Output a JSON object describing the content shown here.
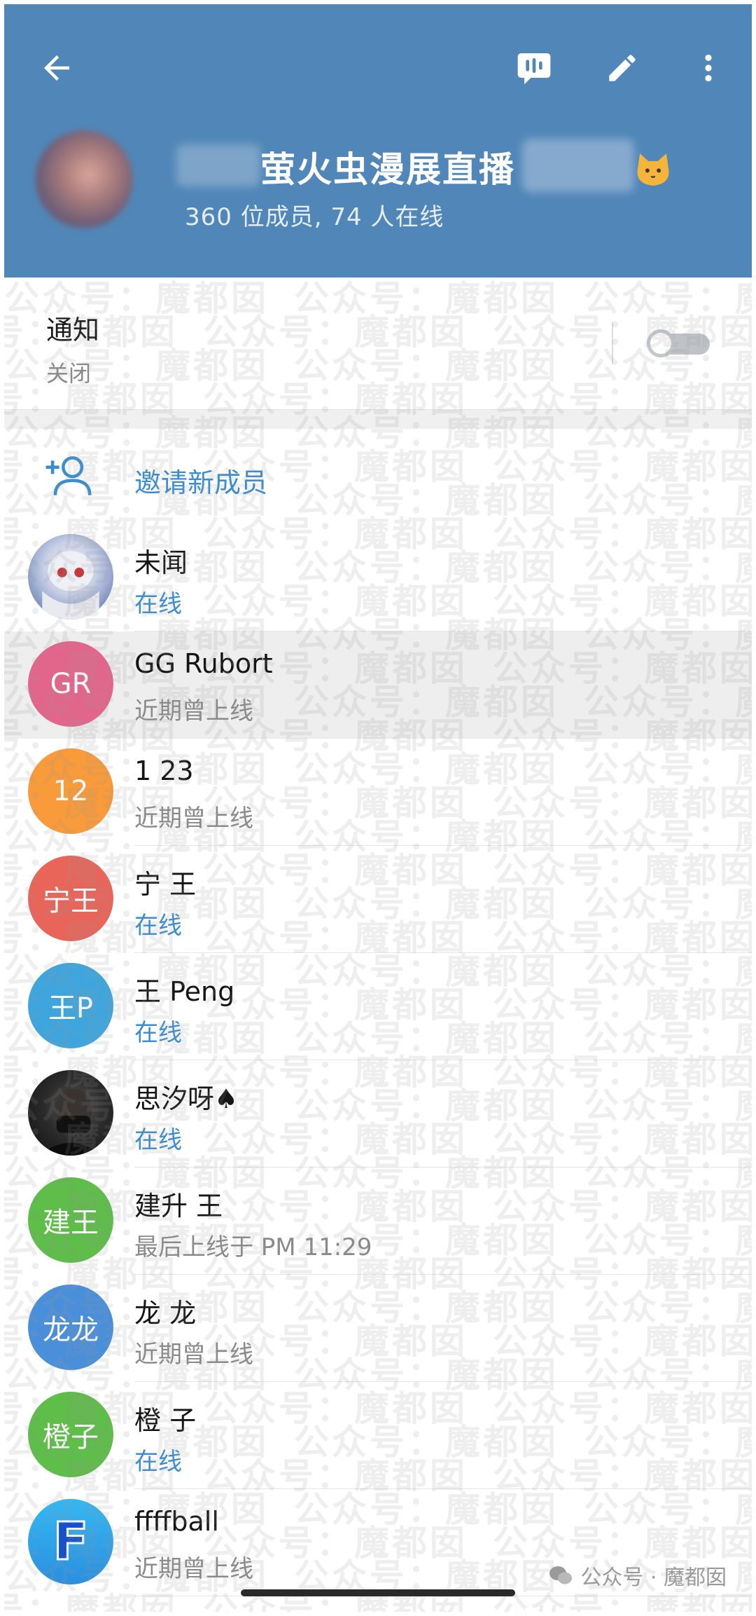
{
  "header": {
    "group_title": "萤火虫漫展直播",
    "subtitle": "360 位成员, 74 人在线",
    "colors": {
      "header_bg": "#5087b8",
      "accent_blue": "#3a8dd0"
    }
  },
  "icons": {
    "back": "arrow-left-icon",
    "voice_chat": "voice-chat-icon",
    "edit": "pencil-icon",
    "more": "more-vertical-icon",
    "invite": "add-user-icon"
  },
  "notifications": {
    "title": "通知",
    "value": "关闭",
    "enabled": false
  },
  "invite": {
    "label": "邀请新成员"
  },
  "members": [
    {
      "name": "未闻",
      "status": "在线",
      "online": true,
      "initials": "",
      "avatar_color": "#c9d4ea",
      "photo": true,
      "highlight": false
    },
    {
      "name": "GG Rubort",
      "status": "近期曾上线",
      "online": false,
      "initials": "GR",
      "avatar_color": "#e2668c",
      "photo": false,
      "highlight": true
    },
    {
      "name": "1 23",
      "status": "近期曾上线",
      "online": false,
      "initials": "12",
      "avatar_color": "#f99b3a",
      "photo": false,
      "highlight": false
    },
    {
      "name": "宁 王",
      "status": "在线",
      "online": true,
      "initials": "宁王",
      "avatar_color": "#e9655a",
      "photo": false,
      "highlight": false
    },
    {
      "name": "王 Peng",
      "status": "在线",
      "online": true,
      "initials": "王P",
      "avatar_color": "#3fa6dd",
      "photo": false,
      "highlight": false
    },
    {
      "name": "思汐呀♠",
      "status": "在线",
      "online": true,
      "initials": "",
      "avatar_color": "#1d1d1d",
      "photo": true,
      "highlight": false
    },
    {
      "name": "建升 王",
      "status": "最后上线于 PM 11:29",
      "online": false,
      "initials": "建王",
      "avatar_color": "#5fbd4a",
      "photo": false,
      "highlight": false
    },
    {
      "name": "龙 龙",
      "status": "近期曾上线",
      "online": false,
      "initials": "龙龙",
      "avatar_color": "#4a8fda",
      "photo": false,
      "highlight": false
    },
    {
      "name": "橙 子",
      "status": "在线",
      "online": true,
      "initials": "橙子",
      "avatar_color": "#5fbd4a",
      "photo": false,
      "highlight": false
    },
    {
      "name": "ffffball",
      "status": "近期曾上线",
      "online": false,
      "initials": "F",
      "avatar_color": "#2fa2e8",
      "photo": false,
      "highlight": false
    }
  ],
  "watermark": {
    "text": "公众号：魔都囡"
  },
  "footer": {
    "source": "公众号 · 魔都囡"
  }
}
